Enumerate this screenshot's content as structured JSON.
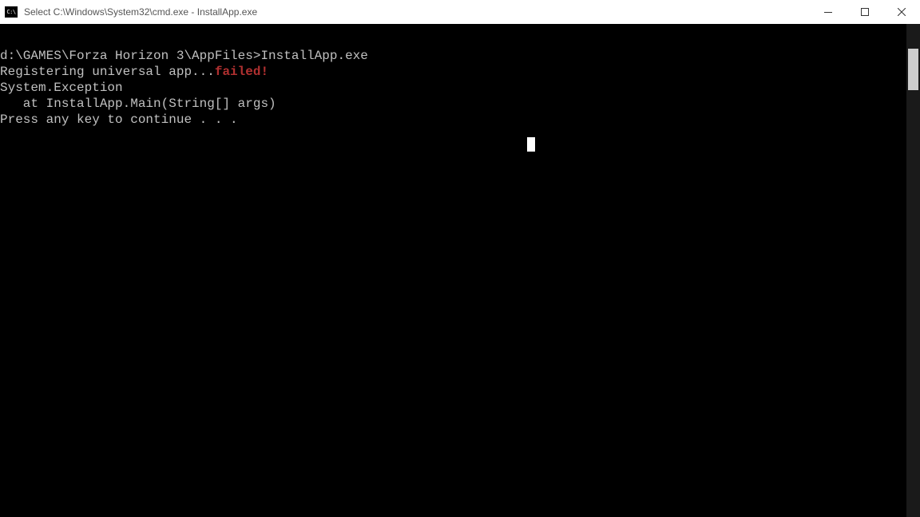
{
  "window": {
    "icon_label": "C:\\",
    "title": "Select C:\\Windows\\System32\\cmd.exe - InstallApp.exe"
  },
  "console": {
    "line1_prompt": "d:\\GAMES\\Forza Horizon 3\\AppFiles>",
    "line1_command": "InstallApp.exe",
    "line2_prefix": "Registering universal app...",
    "line2_failed": "failed!",
    "line3": "System.Exception",
    "line4": "   at InstallApp.Main(String[] args)",
    "line5": "Press any key to continue . . ."
  }
}
